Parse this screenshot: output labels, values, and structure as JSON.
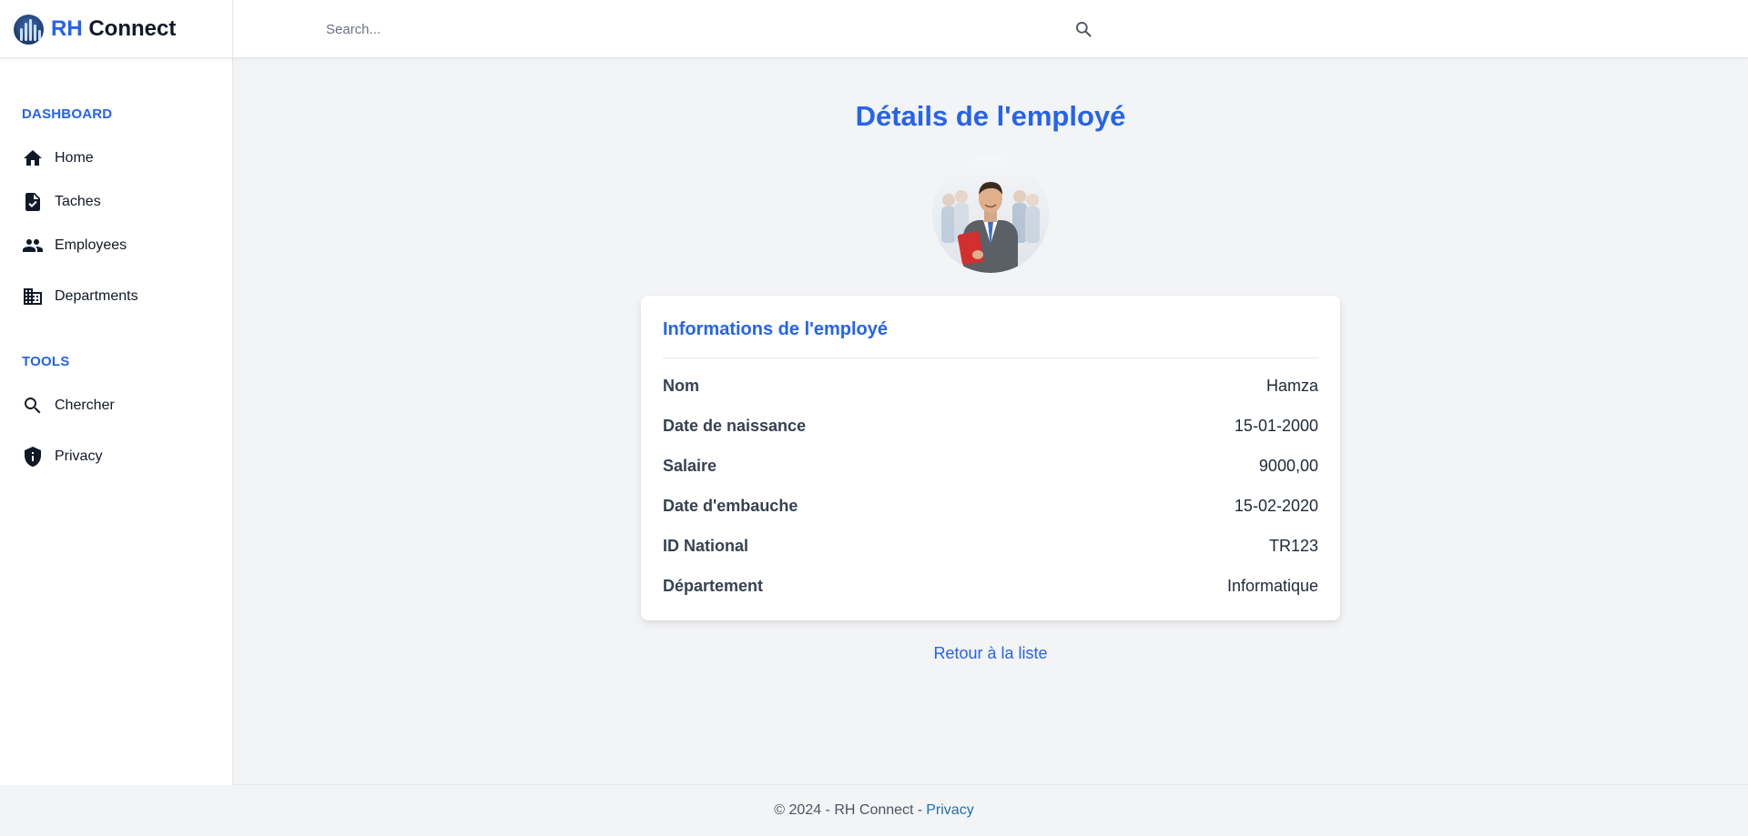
{
  "brand": {
    "prefix": "RH",
    "name": "Connect"
  },
  "search": {
    "placeholder": "Search..."
  },
  "sidebar": {
    "sections": [
      {
        "title": "DASHBOARD",
        "items": [
          {
            "label": "Home",
            "icon": "home-icon"
          },
          {
            "label": "Taches",
            "icon": "task-icon"
          },
          {
            "label": "Employees",
            "icon": "people-icon"
          },
          {
            "label": "Departments",
            "icon": "building-icon"
          }
        ]
      },
      {
        "title": "TOOLS",
        "items": [
          {
            "label": "Chercher",
            "icon": "search-icon"
          },
          {
            "label": "Privacy",
            "icon": "shield-icon"
          }
        ]
      }
    ]
  },
  "main": {
    "title": "Détails de l'employé",
    "avatar_icon": "employee-photo",
    "card": {
      "title": "Informations de l'employé",
      "rows": [
        {
          "label": "Nom",
          "value": "Hamza"
        },
        {
          "label": "Date de naissance",
          "value": "15-01-2000"
        },
        {
          "label": "Salaire",
          "value": "9000,00"
        },
        {
          "label": "Date d'embauche",
          "value": "15-02-2020"
        },
        {
          "label": "ID National",
          "value": "TR123"
        },
        {
          "label": "Département",
          "value": "Informatique"
        }
      ]
    },
    "back_link": "Retour à la liste"
  },
  "footer": {
    "text": "© 2024 - RH Connect -",
    "link": "Privacy"
  },
  "colors": {
    "accent": "#2563eb",
    "background": "#f3f4f6",
    "footer_link": "#1d6fb5"
  }
}
